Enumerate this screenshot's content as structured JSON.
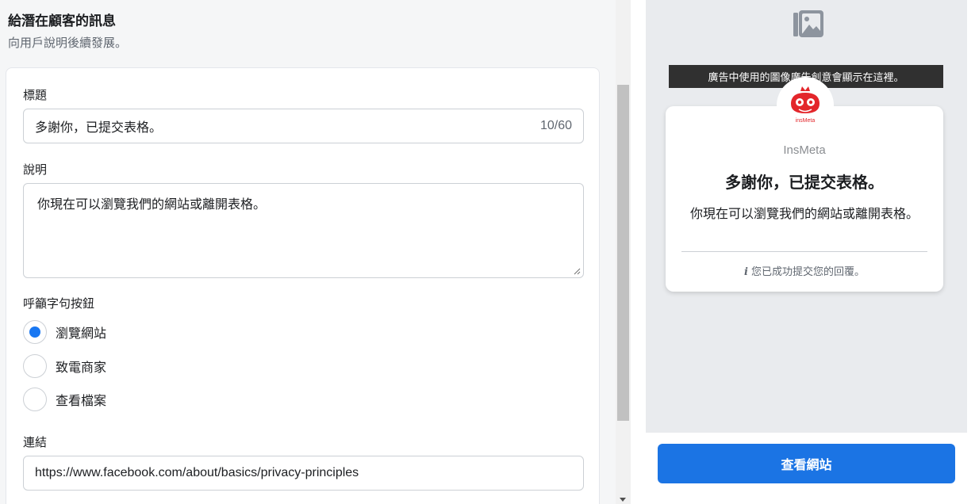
{
  "section": {
    "title": "給潛在顧客的訊息",
    "subtitle": "向用戶說明後續發展。"
  },
  "form": {
    "headline_label": "標題",
    "headline_value": "多謝你，已提交表格。",
    "headline_counter": "10/60",
    "description_label": "說明",
    "description_value": "你現在可以瀏覽我們的網站或離開表格。",
    "cta_label": "呼籲字句按鈕",
    "cta_options": [
      {
        "label": "瀏覽網站",
        "checked": true
      },
      {
        "label": "致電商家",
        "checked": false
      },
      {
        "label": "查看檔案",
        "checked": false
      }
    ],
    "link_label": "連結",
    "link_value": "https://www.facebook.com/about/basics/privacy-principles"
  },
  "preview": {
    "tooltip": "廣告中使用的圖像廣告創意會顯示在這裡。",
    "brand_name": "InsMeta",
    "logo_text": "insMeta",
    "title": "多謝你，已提交表格。",
    "description": "你現在可以瀏覽我們的網站或離開表格。",
    "note": "您已成功提交您的回覆。",
    "button_label": "查看網站"
  },
  "colors": {
    "accent": "#1b74e4",
    "radio_checked": "#1877f2",
    "logo_red": "#e3262b"
  },
  "icons": {
    "image_placeholder": "image-placeholder-icon",
    "info": "info-icon",
    "resize": "resize-grip-icon"
  }
}
